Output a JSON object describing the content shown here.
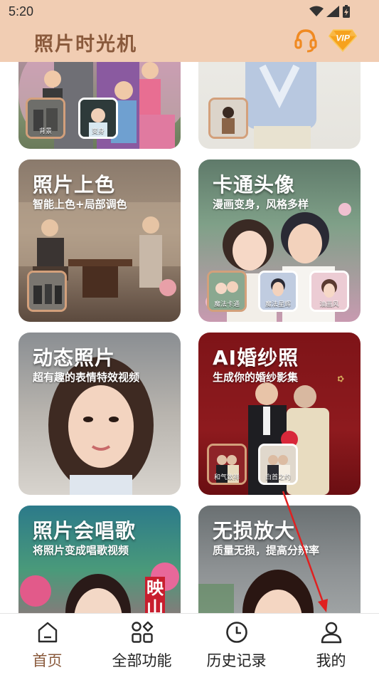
{
  "status_bar": {
    "time": "5:20"
  },
  "header": {
    "title": "照片时光机",
    "vip_label": "VIP"
  },
  "cards": {
    "top_left": {
      "thumbs": [
        "背景",
        "变身"
      ]
    },
    "colorize": {
      "title": "照片上色",
      "subtitle": "智能上色+局部调色"
    },
    "cartoon": {
      "title": "卡通头像",
      "subtitle": "漫画变身，风格多样",
      "thumbs": [
        "魔法卡通",
        "魔法星辉",
        "油画风"
      ]
    },
    "dynamic": {
      "title": "动态照片",
      "subtitle": "超有趣的表情特效视频"
    },
    "wedding": {
      "title": "AI婚纱照",
      "subtitle": "生成你的婚纱影集",
      "thumbs": [
        "和气致祥",
        "白首之约"
      ]
    },
    "sing": {
      "title": "照片会唱歌",
      "subtitle": "将照片变成唱歌视频",
      "poster_text": "映山"
    },
    "upscale": {
      "title": "无损放大",
      "subtitle": "质量无损，提高分辨率"
    }
  },
  "bottom_nav": [
    {
      "label": "首页",
      "icon": "home-icon"
    },
    {
      "label": "全部功能",
      "icon": "grid-icon"
    },
    {
      "label": "历史记录",
      "icon": "clock-icon"
    },
    {
      "label": "我的",
      "icon": "user-icon"
    }
  ],
  "colors": {
    "header_bg": "#f1cdb3",
    "title_brown": "#8a5a3c",
    "accent_orange": "#f08a22"
  }
}
